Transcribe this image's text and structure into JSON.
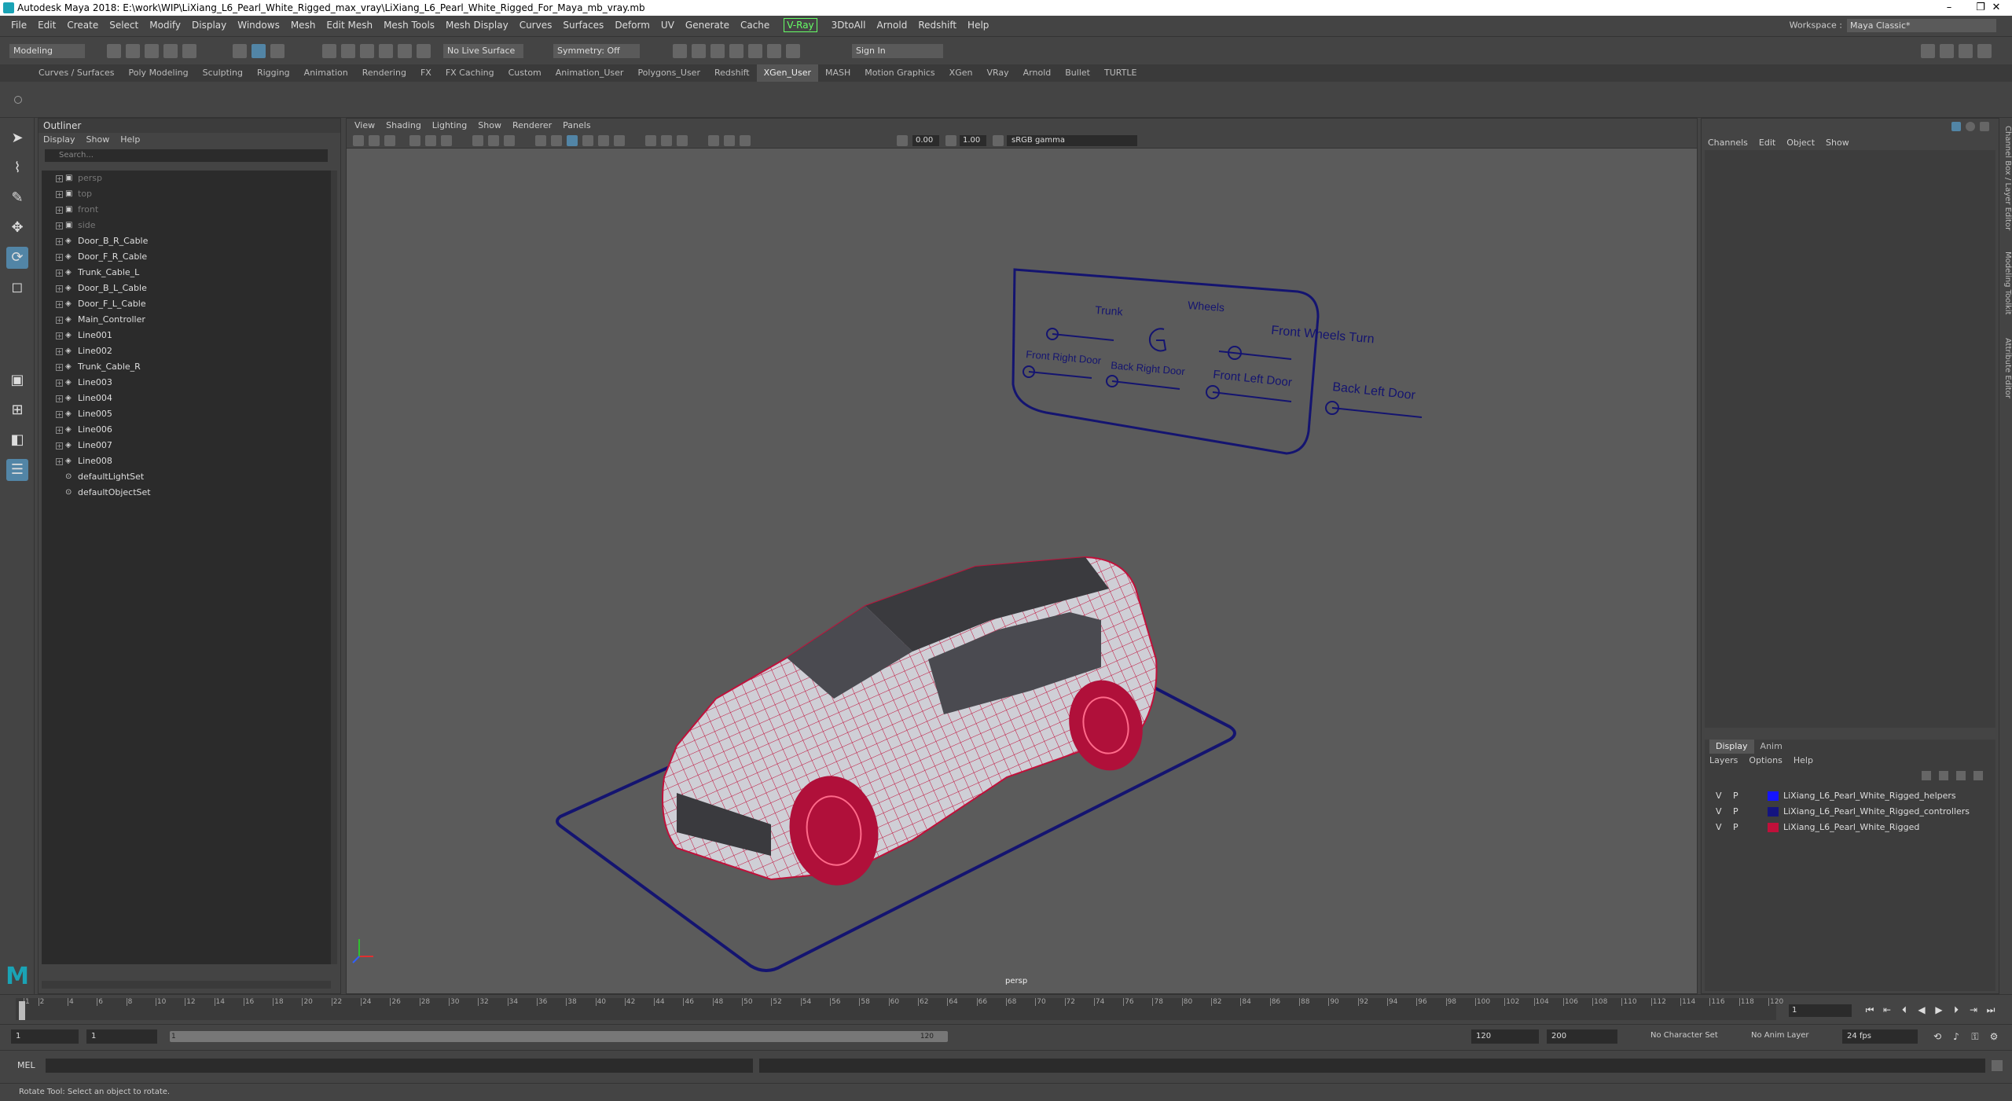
{
  "title": "Autodesk Maya 2018: E:\\work\\WIP\\LiXiang_L6_Pearl_White_Rigged_max_vray\\LiXiang_L6_Pearl_White_Rigged_For_Maya_mb_vray.mb",
  "menu": [
    "File",
    "Edit",
    "Create",
    "Select",
    "Modify",
    "Display",
    "Windows",
    "Mesh",
    "Edit Mesh",
    "Mesh Tools",
    "Mesh Display",
    "Curves",
    "Surfaces",
    "Deform",
    "UV",
    "Generate",
    "Cache"
  ],
  "menu_vray": "V-Ray",
  "menu_right": [
    "3DtoAll",
    "Arnold",
    "Redshift",
    "Help"
  ],
  "workspace": {
    "label": "Workspace :",
    "value": "Maya Classic*"
  },
  "status": {
    "mode": "Modeling",
    "live_surface": "No Live Surface",
    "symmetry": "Symmetry: Off",
    "sign_in": "Sign In"
  },
  "shelf_tabs": [
    "Curves / Surfaces",
    "Poly Modeling",
    "Sculpting",
    "Rigging",
    "Animation",
    "Rendering",
    "FX",
    "FX Caching",
    "Custom",
    "Animation_User",
    "Polygons_User",
    "Redshift",
    "XGen_User",
    "MASH",
    "Motion Graphics",
    "XGen",
    "VRay",
    "Arnold",
    "Bullet",
    "TURTLE"
  ],
  "shelf_active": "XGen_User",
  "outliner": {
    "title": "Outliner",
    "menu": [
      "Display",
      "Show",
      "Help"
    ],
    "search_placeholder": "Search...",
    "items": [
      {
        "name": "persp",
        "dim": true,
        "type": "camera"
      },
      {
        "name": "top",
        "dim": true,
        "type": "camera"
      },
      {
        "name": "front",
        "dim": true,
        "type": "camera"
      },
      {
        "name": "side",
        "dim": true,
        "type": "camera"
      },
      {
        "name": "Door_B_R_Cable",
        "dim": false,
        "type": "curve"
      },
      {
        "name": "Door_F_R_Cable",
        "dim": false,
        "type": "curve"
      },
      {
        "name": "Trunk_Cable_L",
        "dim": false,
        "type": "curve"
      },
      {
        "name": "Door_B_L_Cable",
        "dim": false,
        "type": "curve"
      },
      {
        "name": "Door_F_L_Cable",
        "dim": false,
        "type": "curve"
      },
      {
        "name": "Main_Controller",
        "dim": false,
        "type": "curve"
      },
      {
        "name": "Line001",
        "dim": false,
        "type": "curve"
      },
      {
        "name": "Line002",
        "dim": false,
        "type": "curve"
      },
      {
        "name": "Trunk_Cable_R",
        "dim": false,
        "type": "curve"
      },
      {
        "name": "Line003",
        "dim": false,
        "type": "curve"
      },
      {
        "name": "Line004",
        "dim": false,
        "type": "curve"
      },
      {
        "name": "Line005",
        "dim": false,
        "type": "curve"
      },
      {
        "name": "Line006",
        "dim": false,
        "type": "curve"
      },
      {
        "name": "Line007",
        "dim": false,
        "type": "curve"
      },
      {
        "name": "Line008",
        "dim": false,
        "type": "curve"
      },
      {
        "name": "defaultLightSet",
        "dim": false,
        "type": "set"
      },
      {
        "name": "defaultObjectSet",
        "dim": false,
        "type": "set"
      }
    ]
  },
  "viewport": {
    "menu": [
      "View",
      "Shading",
      "Lighting",
      "Show",
      "Renderer",
      "Panels"
    ],
    "exposure": "0.00",
    "gamma": "1.00",
    "color_space": "sRGB gamma",
    "camera_label": "persp",
    "controller_labels": {
      "trunk": "Trunk",
      "wheels": "Wheels",
      "front_wheels_turn": "Front Wheels Turn",
      "front_right_door": "Front Right Door",
      "back_right_door": "Back Right Door",
      "front_left_door": "Front Left Door",
      "back_left_door": "Back Left Door"
    },
    "controller_color": "#141470",
    "wire_color": "#c0103a"
  },
  "channel_box": {
    "menu": [
      "Channels",
      "Edit",
      "Object",
      "Show"
    ]
  },
  "layer_editor": {
    "tabs": [
      "Display",
      "Anim"
    ],
    "menu": [
      "Layers",
      "Options",
      "Help"
    ],
    "layers": [
      {
        "v": "V",
        "p": "P",
        "color": "#1414ff",
        "name": "LiXiang_L6_Pearl_White_Rigged_helpers"
      },
      {
        "v": "V",
        "p": "P",
        "color": "#141480",
        "name": "LiXiang_L6_Pearl_White_Rigged_controllers"
      },
      {
        "v": "V",
        "p": "P",
        "color": "#c0103a",
        "name": "LiXiang_L6_Pearl_White_Rigged"
      }
    ]
  },
  "side_tabs": [
    "Channel Box / Layer Editor",
    "Modeling Toolkit",
    "Attribute Editor"
  ],
  "timeline": {
    "ticks": [
      1,
      2,
      4,
      6,
      8,
      10,
      12,
      14,
      16,
      18,
      20,
      22,
      24,
      26,
      28,
      30,
      32,
      34,
      36,
      38,
      40,
      42,
      44,
      46,
      48,
      50,
      52,
      54,
      56,
      58,
      60,
      62,
      64,
      66,
      68,
      70,
      72,
      74,
      76,
      78,
      80,
      82,
      84,
      86,
      88,
      90,
      92,
      94,
      96,
      98,
      100,
      102,
      104,
      106,
      108,
      110,
      112,
      114,
      116,
      118,
      120
    ],
    "current": "1"
  },
  "range": {
    "start": "1",
    "start2": "1",
    "bar_start": "1",
    "bar_end": "120",
    "end": "120",
    "end2": "200",
    "character_set": "No Character Set",
    "anim_layer": "No Anim Layer",
    "fps": "24 fps"
  },
  "command": {
    "label": "MEL"
  },
  "help_line": "Rotate Tool: Select an object to rotate."
}
